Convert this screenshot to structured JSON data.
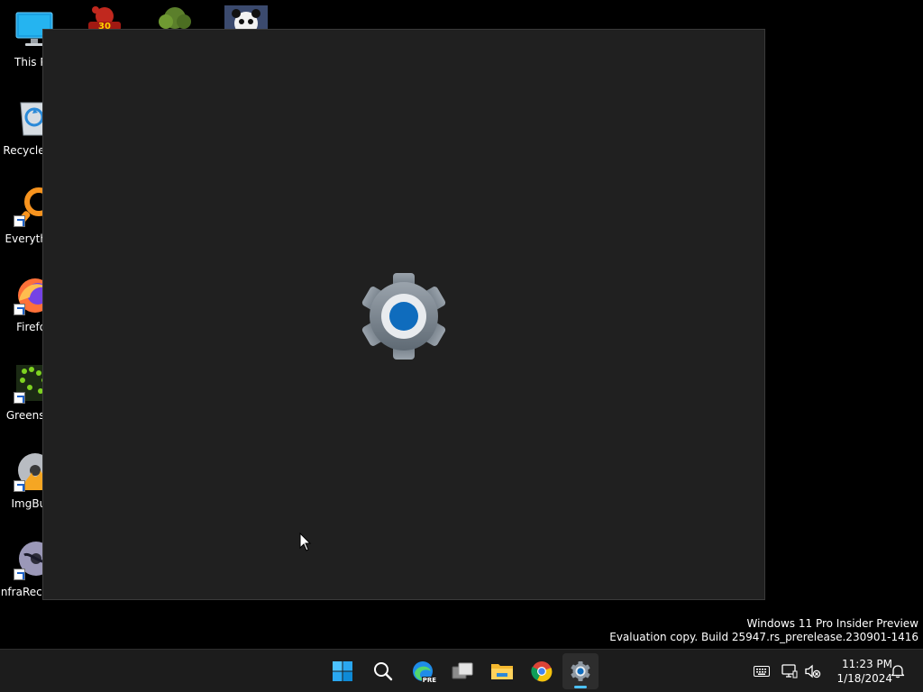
{
  "desktop": {
    "icons": [
      {
        "label": "This PC"
      },
      {
        "label": "Recycle Bin"
      },
      {
        "label": "Everything"
      },
      {
        "label": "Firefox"
      },
      {
        "label": "Greenshot"
      },
      {
        "label": "ImgBurn"
      },
      {
        "label": "InfraRecorder"
      }
    ],
    "top_badge": "30"
  },
  "settings_window": {
    "splash_icon": "gear-icon",
    "accent": "#0f6cbd"
  },
  "watermark": {
    "line1": "Windows 11 Pro Insider Preview",
    "line2": "Evaluation copy. Build 25947.rs_prerelease.230901-1416"
  },
  "taskbar": {
    "background": "#1c1c1c",
    "active_indicator": "#4cc2ff",
    "buttons": [
      {
        "icon": "windows-start-icon"
      },
      {
        "icon": "search-icon"
      },
      {
        "icon": "edge-preview-icon",
        "badge": "PRE"
      },
      {
        "icon": "task-view-icon"
      },
      {
        "icon": "file-explorer-icon"
      },
      {
        "icon": "chrome-icon"
      },
      {
        "icon": "settings-icon"
      }
    ]
  },
  "tray": {
    "time": "11:23 PM",
    "date": "1/18/2024"
  }
}
